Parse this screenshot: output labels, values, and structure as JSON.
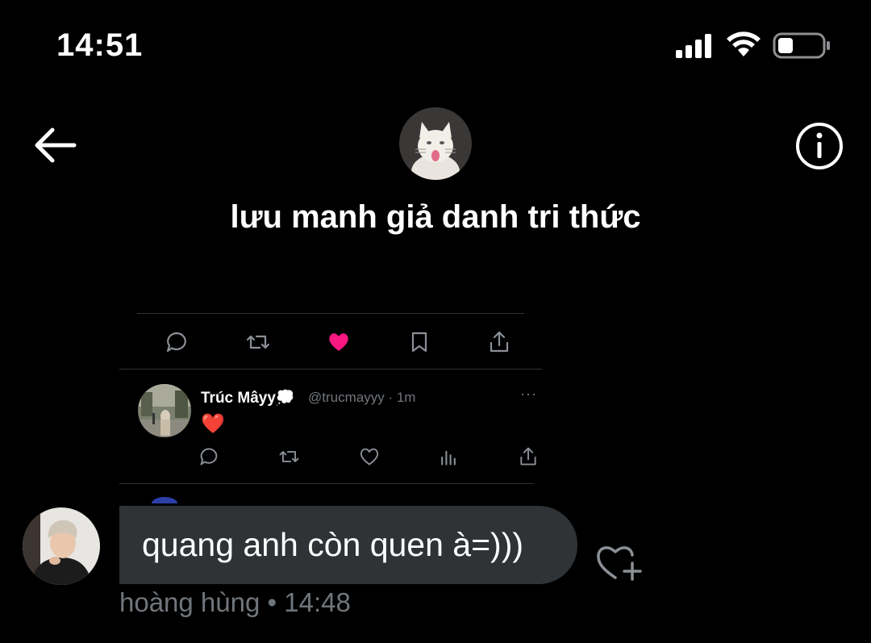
{
  "status_bar": {
    "time": "14:51",
    "icons": [
      "signal-icon",
      "wifi-icon",
      "battery-icon"
    ],
    "battery_level": 0.3
  },
  "header": {
    "title": "lưu manh giả danh tri thức",
    "back_icon": "arrow-left-icon",
    "info_icon": "info-icon"
  },
  "shared_tweet": {
    "top_actions": [
      "reply-icon",
      "retweet-icon",
      "like-filled-icon",
      "bookmark-icon",
      "share-icon"
    ],
    "author_name": "Trúc Mâyy💭",
    "handle_time": "@trucmayyy · 1m",
    "more": "···",
    "body": "❤️",
    "bottom_actions": [
      "reply-icon",
      "retweet-icon",
      "like-icon",
      "analytics-icon",
      "share-icon"
    ]
  },
  "message": {
    "text": "quang anh còn quen à=)))",
    "meta": "hoàng hùng • 14:48",
    "react_icon": "add-reaction-icon"
  },
  "colors": {
    "background": "#000000",
    "bubble": "#2f3336",
    "muted": "#71767b",
    "like": "#f91880"
  }
}
